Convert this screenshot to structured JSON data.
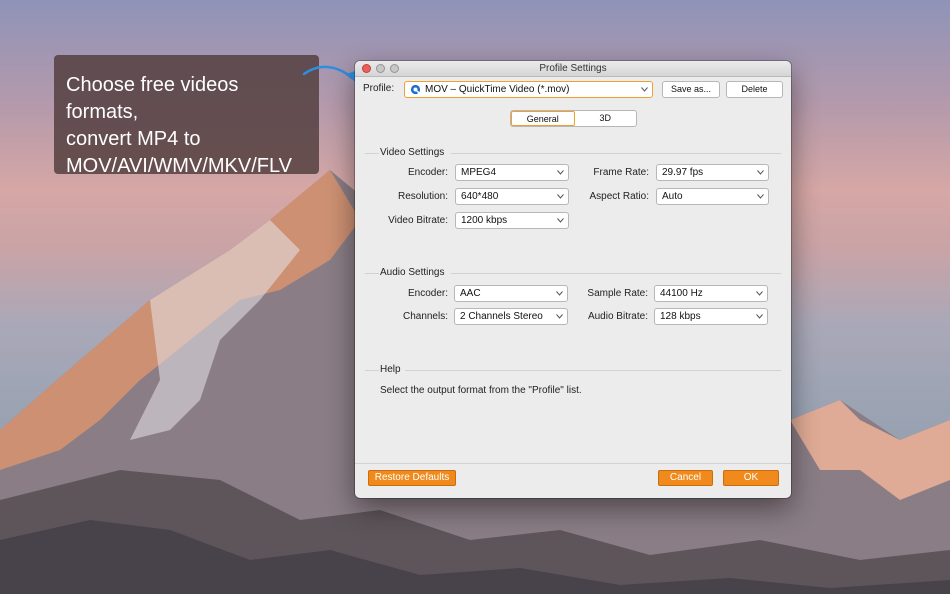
{
  "callout": {
    "line1": "Choose free videos formats,",
    "line2": "convert MP4 to",
    "line3": "MOV/AVI/WMV/MKV/FLV"
  },
  "window": {
    "title": "Profile Settings",
    "profile_label": "Profile:",
    "profile_value": "MOV – QuickTime Video (*.mov)",
    "save_as_label": "Save as...",
    "delete_label": "Delete",
    "tabs": [
      "General",
      "3D"
    ],
    "active_tab": "General"
  },
  "video": {
    "title": "Video Settings",
    "encoder_label": "Encoder:",
    "encoder_value": "MPEG4",
    "resolution_label": "Resolution:",
    "resolution_value": "640*480",
    "bitrate_label": "Video Bitrate:",
    "bitrate_value": "1200 kbps",
    "framerate_label": "Frame Rate:",
    "framerate_value": "29.97 fps",
    "aspect_label": "Aspect Ratio:",
    "aspect_value": "Auto"
  },
  "audio": {
    "title": "Audio Settings",
    "encoder_label": "Encoder:",
    "encoder_value": "AAC",
    "channels_label": "Channels:",
    "channels_value": "2 Channels Stereo",
    "samplerate_label": "Sample Rate:",
    "samplerate_value": "44100 Hz",
    "bitrate_label": "Audio Bitrate:",
    "bitrate_value": "128 kbps"
  },
  "help": {
    "title": "Help",
    "text": "Select the output format from the \"Profile\" list."
  },
  "footer": {
    "restore_label": "Restore Defaults",
    "cancel_label": "Cancel",
    "ok_label": "OK"
  },
  "colors": {
    "accent": "#f08a1c",
    "close_button": "#f25d55"
  },
  "icons": {
    "profile_icon": "quicktime-icon",
    "dropdown": "chevron-down-icon"
  }
}
